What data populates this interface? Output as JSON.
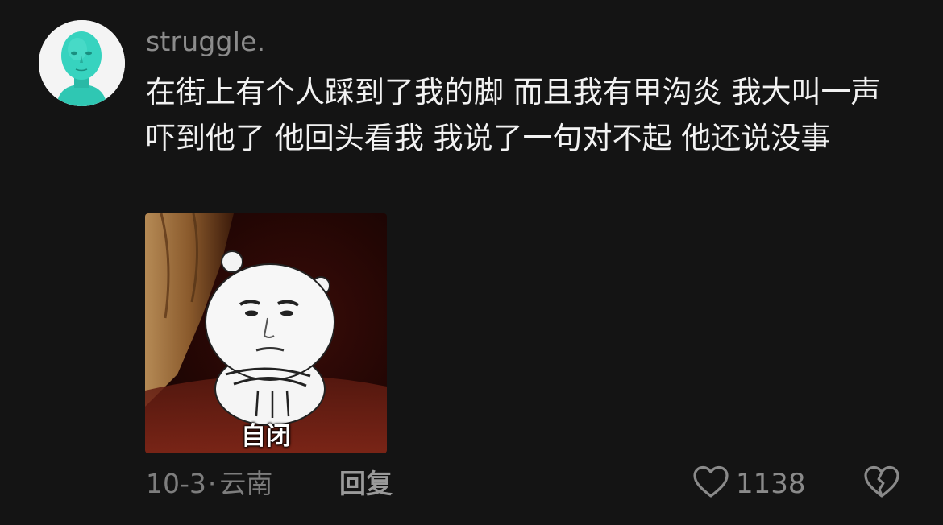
{
  "comment": {
    "username": "struggle.",
    "text": "在街上有个人踩到了我的脚 而且我有甲沟炎 我大叫一声 吓到他了 他回头看我 我说了一句对不起 他还说没事",
    "sticker_caption": "自闭",
    "date": "10-3",
    "separator": "·",
    "location": "云南",
    "reply_label": "回复",
    "like_count": "1138"
  },
  "icons": {
    "avatar": "green-mask-face-avatar",
    "like": "heart-outline-icon",
    "dislike": "broken-heart-icon"
  },
  "colors": {
    "background": "#141414",
    "username": "#8c8c8c",
    "text": "#f2f2f2",
    "meta": "#7d7d7d"
  }
}
